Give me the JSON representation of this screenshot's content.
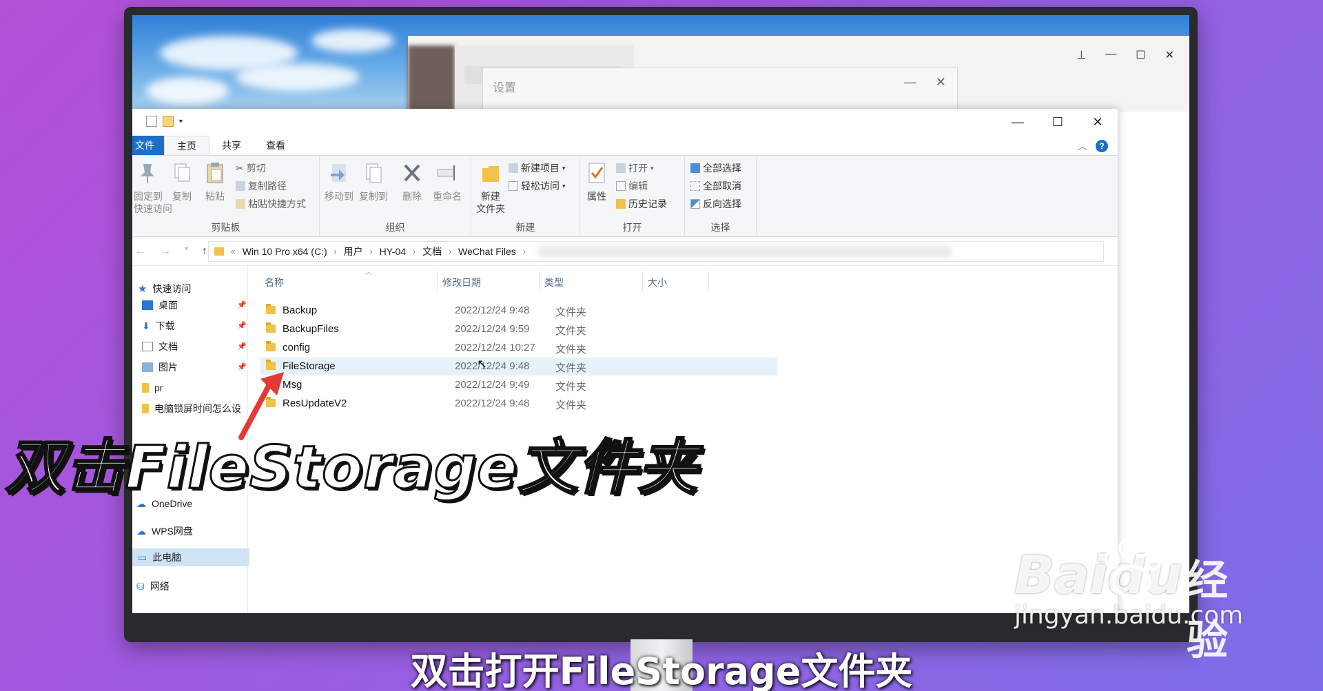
{
  "wechat": {
    "settings_title": "设置"
  },
  "explorer": {
    "tabs": [
      "文件",
      "主页",
      "共享",
      "查看"
    ],
    "ribbon": {
      "clipboard": {
        "pin": "固定到\n快速访问",
        "copy": "复制",
        "paste": "粘贴",
        "cut": "剪切",
        "copy_path": "复制路径",
        "paste_shortcut": "粘贴快捷方式",
        "label": "剪贴板"
      },
      "organize": {
        "move_to": "移动到",
        "copy_to": "复制到",
        "delete": "删除",
        "rename": "重命名",
        "label": "组织"
      },
      "new": {
        "new_folder": "新建\n文件夹",
        "new_item": "新建项目",
        "easy_access": "轻松访问",
        "label": "新建"
      },
      "open": {
        "properties": "属性",
        "open": "打开",
        "edit": "编辑",
        "history": "历史记录",
        "label": "打开"
      },
      "select": {
        "select_all": "全部选择",
        "select_none": "全部取消",
        "invert": "反向选择",
        "label": "选择"
      }
    },
    "breadcrumb": [
      "Win 10 Pro x64 (C:)",
      "用户",
      "HY-04",
      "文档",
      "WeChat Files"
    ],
    "nav_pane": {
      "quick_access": "快速访问",
      "items": [
        "桌面",
        "下载",
        "文档",
        "图片",
        "pr",
        "电脑锁屏时间怎么设"
      ],
      "onedrive": "OneDrive",
      "wps": "WPS网盘",
      "this_pc": "此电脑",
      "network": "网络"
    },
    "columns": [
      "名称",
      "修改日期",
      "类型",
      "大小"
    ],
    "files": [
      {
        "name": "Backup",
        "date": "2022/12/24 9:48",
        "type": "文件夹"
      },
      {
        "name": "BackupFiles",
        "date": "2022/12/24 9:59",
        "type": "文件夹"
      },
      {
        "name": "config",
        "date": "2022/12/24 10:27",
        "type": "文件夹"
      },
      {
        "name": "FileStorage",
        "date": "2022/12/24 9:48",
        "type": "文件夹"
      },
      {
        "name": "Msg",
        "date": "2022/12/24 9:49",
        "type": "文件夹"
      },
      {
        "name": "ResUpdateV2",
        "date": "2022/12/24 9:48",
        "type": "文件夹"
      }
    ]
  },
  "overlay": {
    "caption": "双击FileStorage文件夹",
    "subtitle": "双击打开FileStorage文件夹",
    "watermark_logo": "Baidu",
    "watermark_cn": "经验",
    "watermark_url": "jingyan.baidu.com"
  },
  "colors": {
    "accent": "#1b6fc8",
    "folder": "#f3c24c",
    "arrow": "#e53935"
  }
}
